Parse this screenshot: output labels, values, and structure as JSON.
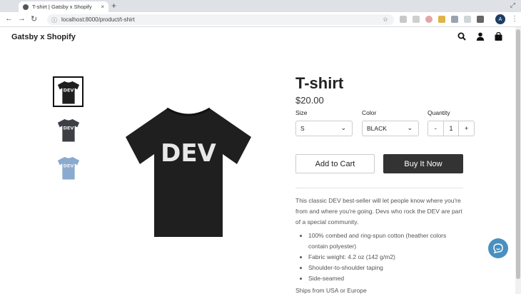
{
  "browser": {
    "tab_title": "T-shirt | Gatsby x Shopify",
    "tab_close": "×",
    "new_tab": "+",
    "url": "localhost:8000/product/t-shirt",
    "avatar_letter": "A"
  },
  "header": {
    "brand": "Gatsby x Shopify"
  },
  "product": {
    "title": "T-shirt",
    "price": "$20.00",
    "shirt_text": "DEV",
    "thumbnails": [
      {
        "color": "#1f1f1f"
      },
      {
        "color": "#3d3f45"
      },
      {
        "color": "#8aaacf"
      }
    ],
    "main_color": "#1f1f1f"
  },
  "options": {
    "size_label": "Size",
    "size_value": "S",
    "color_label": "Color",
    "color_value": "BLACK",
    "quantity_label": "Quantity",
    "qty_minus": "-",
    "qty_value": "1",
    "qty_plus": "+"
  },
  "actions": {
    "add_to_cart": "Add to Cart",
    "buy_now": "Buy It Now"
  },
  "description": {
    "intro": "This classic DEV best-seller will let people know where you're from and where you're going. Devs who rock the DEV are part of a special community.",
    "bullets": [
      "100% combed and ring-spun cotton (heather colors contain polyester)",
      "Fabric weight: 4.2 oz (142 g/m2)",
      "Shoulder-to-shoulder taping",
      "Side-seamed"
    ],
    "ships": "Ships from USA or Europe"
  },
  "colors": {
    "buy_button": "#333333",
    "chat_bubble": "#4a90c0"
  }
}
